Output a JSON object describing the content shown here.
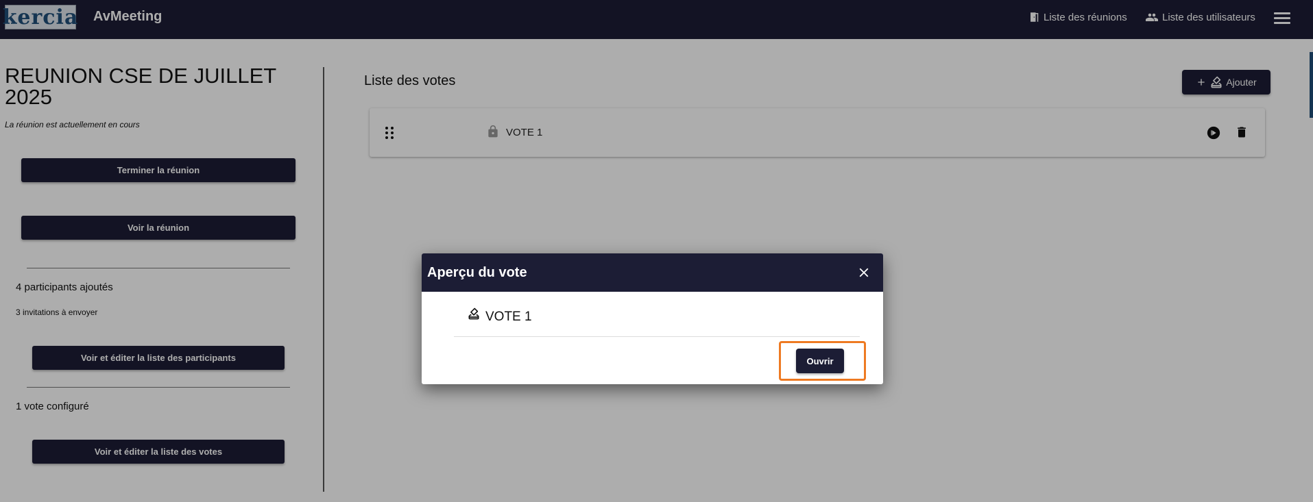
{
  "header": {
    "logo_text": "kercia",
    "app_name": "AvMeeting",
    "nav": {
      "meetings": "Liste des réunions",
      "users": "Liste des utilisateurs"
    }
  },
  "meeting": {
    "title": "REUNION CSE DE JUILLET 2025",
    "status": "La réunion est actuellement en cours",
    "end_button": "Terminer la réunion",
    "view_button": "Voir la réunion",
    "participants_count": "4 participants ajoutés",
    "invitations_count": "3 invitations à envoyer",
    "participants_button": "Voir et éditer la liste des participants",
    "votes_count": "1 vote configuré",
    "votes_button": "Voir et éditer la liste des votes"
  },
  "votes": {
    "title": "Liste des votes",
    "add_button": "Ajouter",
    "items": [
      {
        "name": "VOTE 1"
      }
    ]
  },
  "modal": {
    "title": "Aperçu du vote",
    "vote_name": "VOTE 1",
    "open_button": "Ouvrir",
    "highlight_color": "#ee7a22"
  },
  "colors": {
    "primary": "#1c1d35",
    "accent": "#1f4e79"
  }
}
